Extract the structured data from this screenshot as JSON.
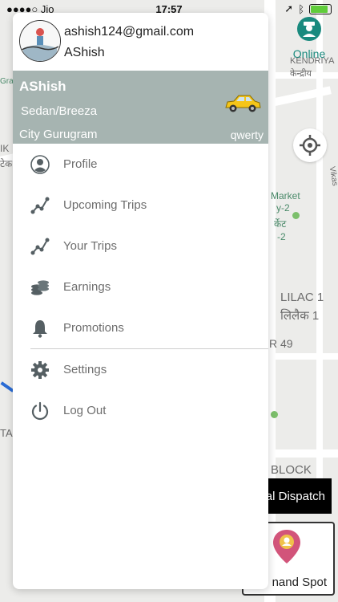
{
  "status_bar": {
    "carrier": "●●●●○ Jio",
    "time": "17:57"
  },
  "profile": {
    "email": "ashish124@gmail.com",
    "name": "AShish"
  },
  "vehicle": {
    "driver": "AShish",
    "model": "Sedan/Breeza",
    "city": "City Gurugram",
    "code": "qwerty"
  },
  "menu": [
    {
      "label": "Profile",
      "icon": "person-icon"
    },
    {
      "label": "Upcoming Trips",
      "icon": "route-icon"
    },
    {
      "label": "Your Trips",
      "icon": "route-icon"
    },
    {
      "label": "Earnings",
      "icon": "coins-icon"
    },
    {
      "label": "Promotions",
      "icon": "bell-icon"
    },
    {
      "label": "Settings",
      "icon": "gear-icon"
    },
    {
      "label": "Log Out",
      "icon": "power-icon"
    }
  ],
  "status": {
    "online_label": "Online"
  },
  "map": {
    "labels": [
      "KENDRIYA",
      "केन्द्रीय",
      "Market",
      "y-2",
      "र्केट",
      "-2",
      "LILAC 1",
      "लिलैक 1",
      "R 49",
      "BLOCK",
      "Vikas",
      "IK",
      "टेक",
      "TA",
      "Gra"
    ]
  },
  "actions": {
    "dispatch_label": "al Dispatch",
    "spot_label": "nand Spot"
  },
  "colors": {
    "vehicle_band": "#a6b4b1",
    "online": "#1a8a7e",
    "menu_icon": "#555f63"
  }
}
